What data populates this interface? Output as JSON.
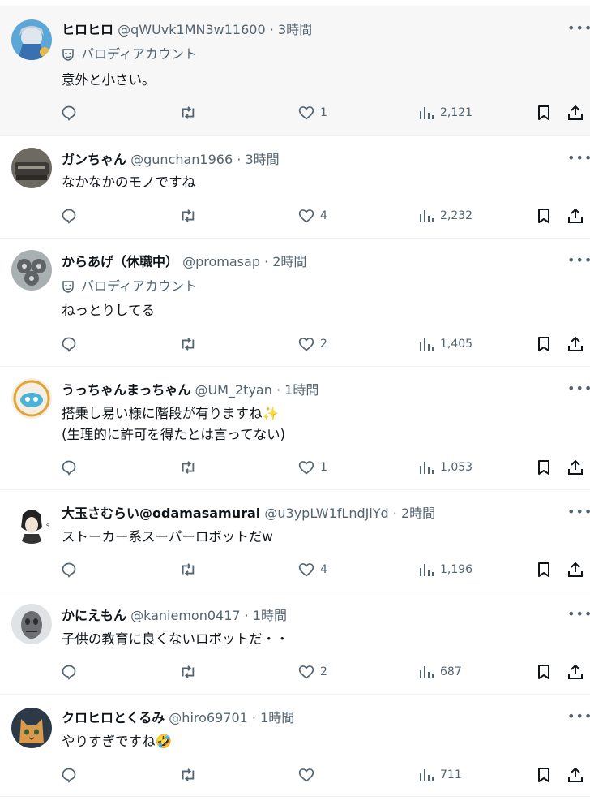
{
  "colors": {
    "text": "#0f1419",
    "secondary": "#536471",
    "divider": "#eff3f4",
    "highlight_bg": "#f7f7f7"
  },
  "icons": [
    "reply-icon",
    "retweet-icon",
    "heart-icon",
    "views-icon",
    "bookmark-icon",
    "share-icon",
    "more-icon",
    "parody-mask-icon"
  ],
  "tweets": [
    {
      "name": "ヒロヒロ",
      "handle": "@qWUvk1MN3w11600",
      "sep": "·",
      "time": "3時間",
      "parody": "パロディアカウント",
      "lines": [
        "意外と小さい。"
      ],
      "likes": "1",
      "views": "2,121"
    },
    {
      "name": "ガンちゃん",
      "handle": "@gunchan1966",
      "sep": "·",
      "time": "3時間",
      "lines": [
        "なかなかのモノですね"
      ],
      "likes": "4",
      "views": "2,232"
    },
    {
      "name": "からあげ（休職中）",
      "handle": "@promasap",
      "sep": "·",
      "time": "2時間",
      "parody": "パロディアカウント",
      "lines": [
        "ねっとりしてる"
      ],
      "likes": "2",
      "views": "1,405"
    },
    {
      "name": "うっちゃんまっちゃん",
      "handle": "@UM_2tyan",
      "sep": "·",
      "time": "1時間",
      "lines": [
        "搭乗し易い様に階段が有りますね✨",
        "(生理的に許可を得たとは言ってない)"
      ],
      "likes": "1",
      "views": "1,053"
    },
    {
      "name": "大玉さむらい@odamasamurai",
      "handle": "@u3ypLW1fLndJiYd",
      "sep": "·",
      "time": "2時間",
      "lines": [
        "ストーカー系スーパーロボットだw"
      ],
      "likes": "4",
      "views": "1,196"
    },
    {
      "name": "かにえもん",
      "handle": "@kaniemon0417",
      "sep": "·",
      "time": "1時間",
      "lines": [
        "子供の教育に良くないロボットだ・・"
      ],
      "likes": "2",
      "views": "687"
    },
    {
      "name": "クロヒロとくるみ",
      "handle": "@hiro69701",
      "sep": "·",
      "time": "1時間",
      "lines": [
        "やりすぎですね🤣"
      ],
      "likes": "",
      "views": "711"
    }
  ]
}
